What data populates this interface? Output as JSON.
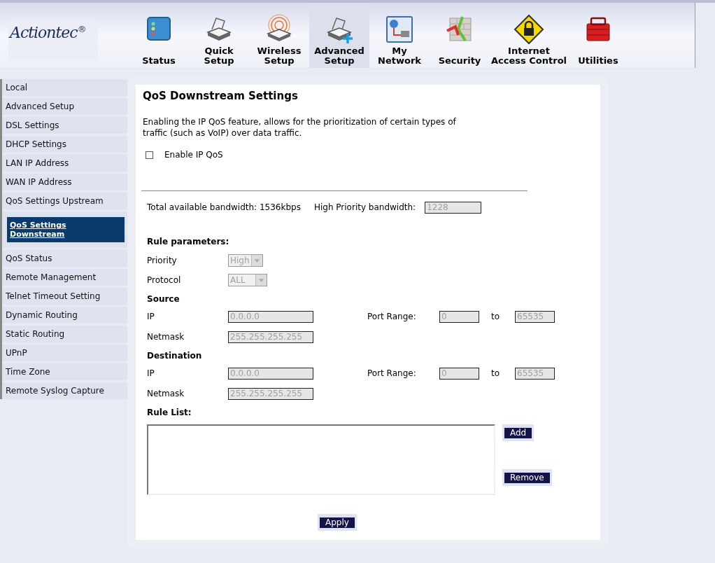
{
  "logo": {
    "text": "Actiontec",
    "mark": "®"
  },
  "nav": [
    {
      "label": "Status",
      "kind": "status",
      "selected": false
    },
    {
      "label": "Quick Setup",
      "kind": "quick",
      "selected": false
    },
    {
      "label": "Wireless Setup",
      "kind": "wireless",
      "selected": false
    },
    {
      "label": "Advanced Setup",
      "kind": "advanced",
      "selected": true
    },
    {
      "label": "My Network",
      "kind": "network",
      "selected": false
    },
    {
      "label": "Security",
      "kind": "security",
      "selected": false
    },
    {
      "label": "Internet Access Control",
      "kind": "lock",
      "selected": false
    },
    {
      "label": "Utilities",
      "kind": "toolbox",
      "selected": false
    }
  ],
  "sidebar": {
    "items": [
      {
        "label": "Local",
        "selected": false
      },
      {
        "label": "Advanced Setup",
        "selected": false
      },
      {
        "label": "DSL Settings",
        "selected": false
      },
      {
        "label": "DHCP Settings",
        "selected": false
      },
      {
        "label": "LAN IP Address",
        "selected": false
      },
      {
        "label": "WAN IP Address",
        "selected": false
      },
      {
        "label": "QoS Settings Upstream",
        "selected": false
      },
      {
        "label": "QoS Settings Downstream",
        "selected": true
      },
      {
        "label": "QoS Status",
        "selected": false
      },
      {
        "label": "Remote Management",
        "selected": false
      },
      {
        "label": "Telnet Timeout Setting",
        "selected": false
      },
      {
        "label": "Dynamic Routing",
        "selected": false
      },
      {
        "label": "Static Routing",
        "selected": false
      },
      {
        "label": "UPnP",
        "selected": false
      },
      {
        "label": "Time Zone",
        "selected": false
      },
      {
        "label": "Remote Syslog Capture",
        "selected": false
      }
    ]
  },
  "form": {
    "title": "QoS Downstream Settings",
    "description": "Enabling the IP QoS feature, allows for the prioritization of certain types of traffic (such as VoIP) over data traffic.",
    "enable": {
      "label": "Enable IP QoS",
      "checked": false
    },
    "bandwidth": {
      "total": "Total available bandwidth: 1536kbps",
      "priority_label": "High Priority bandwidth:",
      "priority_value": "1228"
    },
    "rules": {
      "heading": "Rule parameters:",
      "disabled": true,
      "priority": {
        "label": "Priority",
        "value": "High"
      },
      "protocol": {
        "label": "Protocol",
        "value": "ALL"
      },
      "groups": [
        {
          "heading": "Source",
          "ip_label": "IP",
          "ip": "0.0.0.0",
          "port_label": "Port Range:",
          "port_from": "0",
          "to_label": "to",
          "port_to": "65535",
          "netmask_label": "Netmask",
          "netmask": "255.255.255.255"
        },
        {
          "heading": "Destination",
          "ip_label": "IP",
          "ip": "0.0.0.0",
          "port_label": "Port Range:",
          "port_from": "0",
          "to_label": "to",
          "port_to": "65535",
          "netmask_label": "Netmask",
          "netmask": "255.255.255.255"
        }
      ]
    },
    "rule_list": {
      "heading": "Rule List:",
      "add": "Add",
      "remove": "Remove"
    },
    "apply": "Apply"
  }
}
